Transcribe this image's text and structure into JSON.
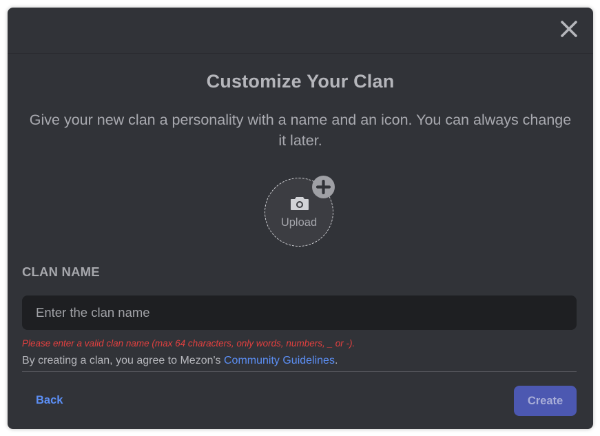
{
  "modal": {
    "title": "Customize Your Clan",
    "subtitle": "Give your new clan a personality with a name and an icon. You can always change it later.",
    "close_icon": "close-icon"
  },
  "upload": {
    "label": "Upload",
    "icon": "camera-icon",
    "badge_icon": "add-icon"
  },
  "form": {
    "field_label": "CLAN NAME",
    "placeholder": "Enter the clan name",
    "value": "",
    "error": "Please enter a valid clan name (max 64 characters, only words, numbers, _ or -).",
    "agreement_prefix": "By creating a clan, you agree to Mezon's ",
    "agreement_link": "Community Guidelines",
    "agreement_suffix": "."
  },
  "footer": {
    "back_label": "Back",
    "create_label": "Create"
  },
  "colors": {
    "background": "#313338",
    "input_background": "#1e1f22",
    "error": "#e3403f",
    "link": "#5c8ff5",
    "primary_button": "#4c58b1"
  }
}
